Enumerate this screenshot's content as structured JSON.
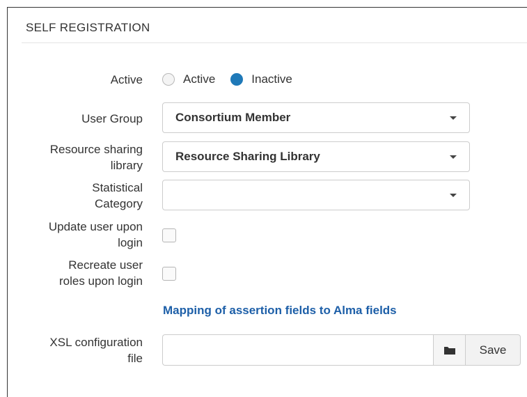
{
  "section": {
    "title": "SELF REGISTRATION"
  },
  "active": {
    "label": "Active",
    "options": [
      {
        "label": "Active",
        "selected": false
      },
      {
        "label": "Inactive",
        "selected": true
      }
    ]
  },
  "user_group": {
    "label": "User Group",
    "value": "Consortium Member"
  },
  "resource_sharing": {
    "label_line1": "Resource sharing",
    "label_line2": "library",
    "value": "Resource Sharing Library"
  },
  "statistical_category": {
    "label_line1": "Statistical",
    "label_line2": "Category",
    "value": ""
  },
  "update_user": {
    "label_line1": "Update user upon",
    "label_line2": "login",
    "checked": false
  },
  "recreate_roles": {
    "label_line1": "Recreate user",
    "label_line2": "roles upon login",
    "checked": false
  },
  "mapping_link": {
    "text": "Mapping of assertion fields to Alma fields"
  },
  "xsl_config": {
    "label_line1": "XSL configuration",
    "label_line2": "file",
    "value": "",
    "browse_icon": "folder-icon",
    "save_label": "Save"
  },
  "colors": {
    "accent": "#1f79b8",
    "link": "#1d5fa8"
  }
}
